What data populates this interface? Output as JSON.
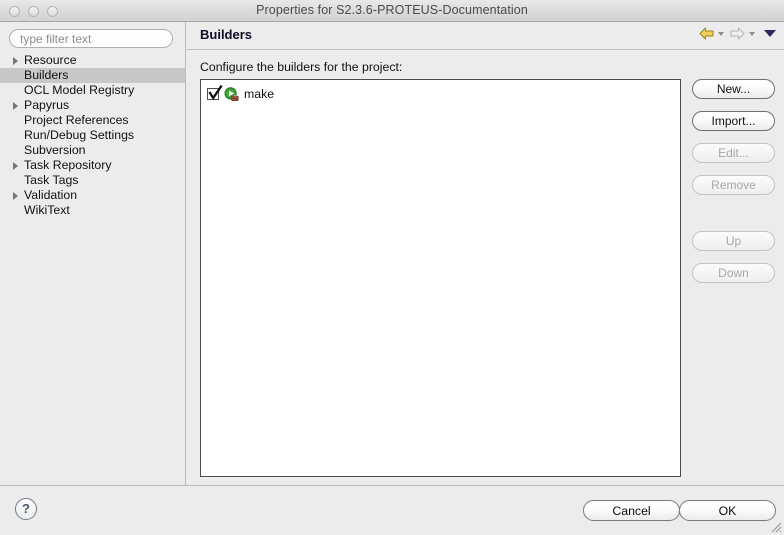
{
  "window": {
    "title": "Properties for S2.3.6-PROTEUS-Documentation",
    "traffic_lights": [
      "close",
      "minimize",
      "zoom"
    ]
  },
  "sidebar": {
    "filter": {
      "value": "",
      "placeholder": "type filter text"
    },
    "items": [
      {
        "label": "Resource",
        "expandable": true,
        "selected": false
      },
      {
        "label": "Builders",
        "expandable": false,
        "selected": true
      },
      {
        "label": "OCL Model Registry",
        "expandable": false,
        "selected": false
      },
      {
        "label": "Papyrus",
        "expandable": true,
        "selected": false
      },
      {
        "label": "Project References",
        "expandable": false,
        "selected": false
      },
      {
        "label": "Run/Debug Settings",
        "expandable": false,
        "selected": false
      },
      {
        "label": "Subversion",
        "expandable": false,
        "selected": false
      },
      {
        "label": "Task Repository",
        "expandable": true,
        "selected": false
      },
      {
        "label": "Task Tags",
        "expandable": false,
        "selected": false
      },
      {
        "label": "Validation",
        "expandable": true,
        "selected": false
      },
      {
        "label": "WikiText",
        "expandable": false,
        "selected": false
      }
    ]
  },
  "main": {
    "page_title": "Builders",
    "instruction": "Configure the builders for the project:",
    "nav": {
      "back_label": "Back",
      "forward_label": "Forward",
      "menu_label": "View Menu"
    },
    "builders": [
      {
        "name": "make",
        "checked": true,
        "icon": "external-tool-builder-icon"
      }
    ],
    "buttons": [
      {
        "label": "New...",
        "enabled": true
      },
      {
        "label": "Import...",
        "enabled": true
      },
      {
        "label": "Edit...",
        "enabled": false
      },
      {
        "label": "Remove",
        "enabled": false
      },
      {
        "label": "Up",
        "enabled": false
      },
      {
        "label": "Down",
        "enabled": false
      }
    ]
  },
  "footer": {
    "help_label": "?",
    "cancel_label": "Cancel",
    "ok_label": "OK"
  },
  "colors": {
    "window_bg": "#ececec",
    "selection": "#c8c8c8",
    "list_bg": "#ffffff",
    "nav_back": "#e8c54b",
    "nav_forward": "#d8d8d8",
    "nav_menu": "#2b2b5e",
    "builder_icon_green": "#3ea832",
    "builder_icon_tool": "#a04b32"
  }
}
